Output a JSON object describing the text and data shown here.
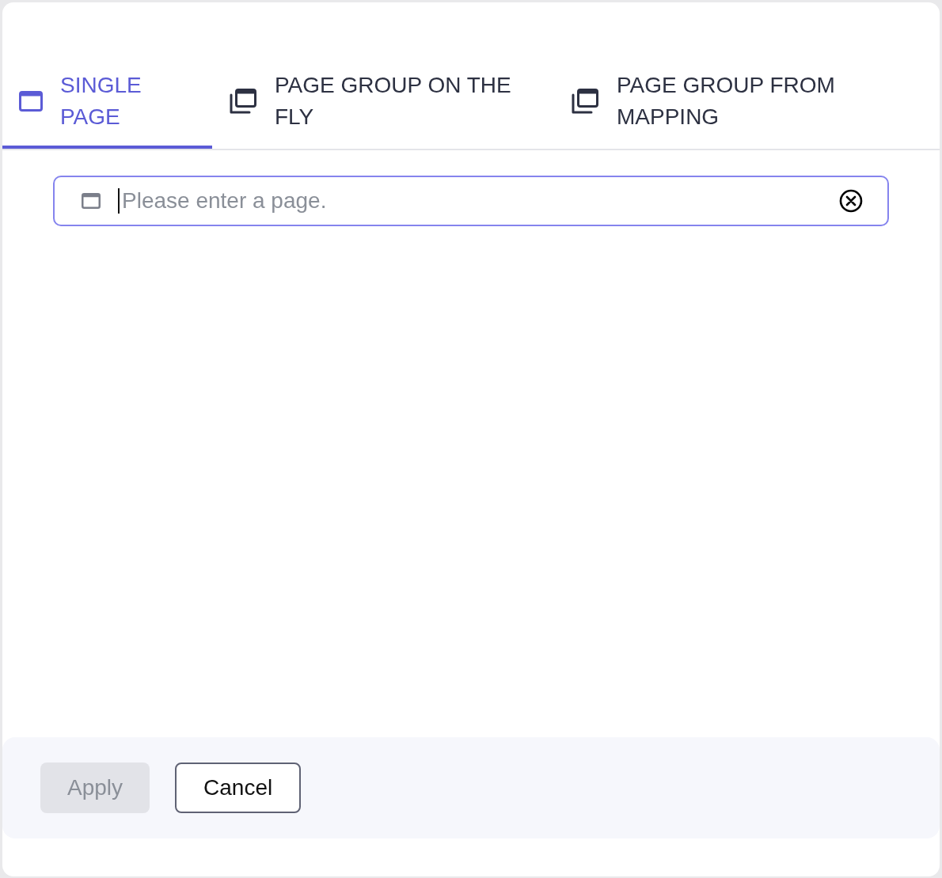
{
  "tabs": [
    {
      "label": "SINGLE PAGE",
      "kind": "single",
      "selected": true
    },
    {
      "label": "PAGE GROUP ON THE FLY",
      "kind": "group",
      "selected": false
    },
    {
      "label": "PAGE GROUP FROM MAPPING",
      "kind": "group",
      "selected": false
    }
  ],
  "page_field": {
    "placeholder": "Please enter a page.",
    "focused": true
  },
  "footer": {
    "buttons": [
      {
        "label": "Apply",
        "kind": "primary",
        "disabled": true
      },
      {
        "label": "Cancel",
        "kind": "secondary",
        "disabled": false
      }
    ]
  }
}
